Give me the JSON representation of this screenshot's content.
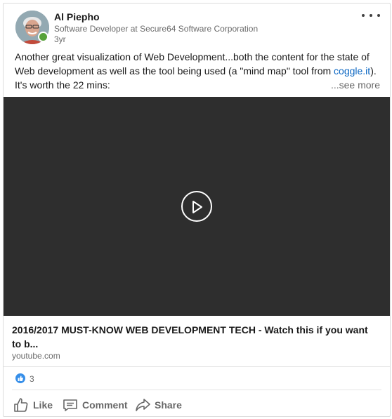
{
  "post": {
    "actor": {
      "name": "Al Piepho",
      "description": "Software Developer at Secure64 Software Corporation",
      "time": "3yr"
    },
    "text": {
      "line1": "Another great visualization of Web Development...both the content for the state of",
      "line2_prefix": "Web development as well as the tool being used (a \"mind map\" tool from ",
      "link": "coggle.it",
      "line2_suffix": ").",
      "line3": "It's worth the 22 mins:",
      "see_more": "...see more"
    },
    "link_preview": {
      "title": "2016/2017 MUST-KNOW WEB DEVELOPMENT TECH - Watch this if you want to b...",
      "domain": "youtube.com"
    },
    "social": {
      "reactions": "3"
    },
    "actions": {
      "like": "Like",
      "comment": "Comment",
      "share": "Share"
    },
    "icons": {
      "menu": "ellipsis-icon",
      "play": "play-icon",
      "reaction": "like-reaction-icon",
      "like": "thumbs-up-icon",
      "comment": "comment-icon",
      "share": "share-arrow-icon"
    },
    "colors": {
      "link": "#0a66c2",
      "presence": "#57a23a",
      "reaction": "#378fe9",
      "video_bg": "#2e2e2e"
    }
  }
}
